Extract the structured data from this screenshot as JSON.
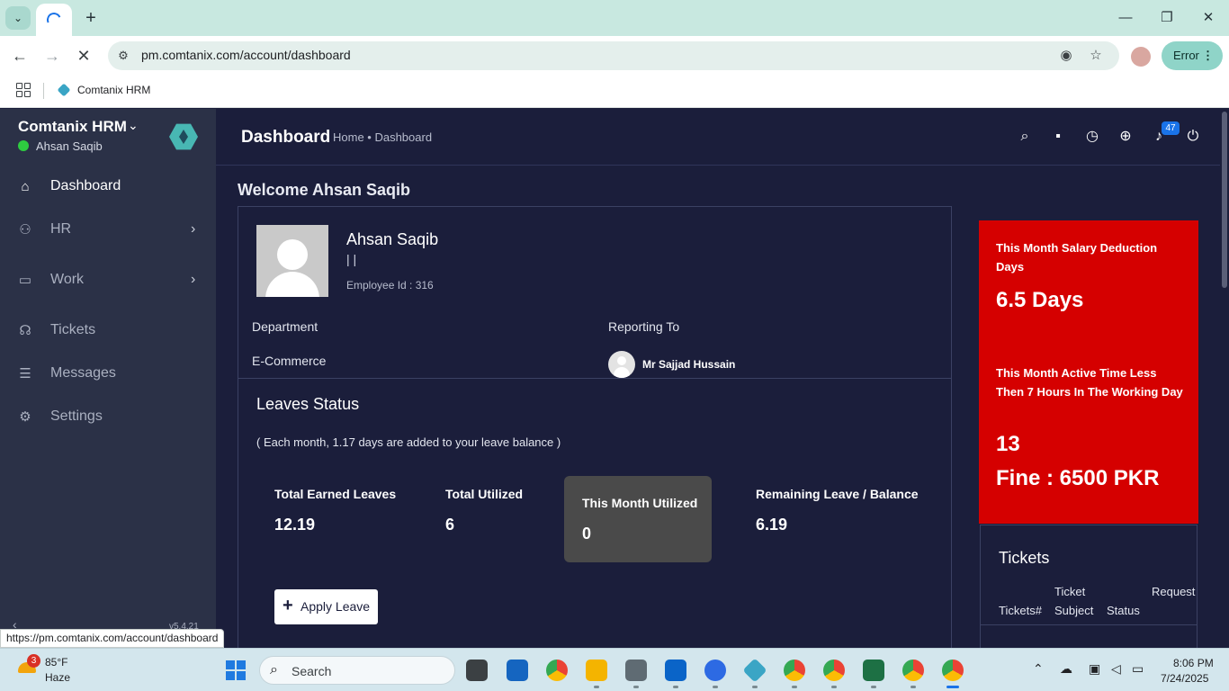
{
  "browser": {
    "tab_dropdown_icon": "chevron-down-icon",
    "new_tab_symbol": "+",
    "window_controls": {
      "minimize": "—",
      "maximize": "❐",
      "close": "✕"
    },
    "url": "pm.comtanix.com/account/dashboard",
    "error_label": "Error",
    "bookmark_label": "Comtanix HRM",
    "status_url": "https://pm.comtanix.com/account/dashboard"
  },
  "sidebar": {
    "brand": "Comtanix HRM",
    "user": "Ahsan Saqib",
    "items": [
      {
        "label": "Dashboard",
        "icon": "home-icon",
        "active": true
      },
      {
        "label": "HR",
        "icon": "users-icon",
        "has_children": true
      },
      {
        "label": "Work",
        "icon": "briefcase-icon",
        "has_children": true
      },
      {
        "label": "Tickets",
        "icon": "headset-icon"
      },
      {
        "label": "Messages",
        "icon": "message-icon"
      },
      {
        "label": "Settings",
        "icon": "gear-icon"
      }
    ],
    "collapse_symbol": "‹",
    "version": "v5.4.21"
  },
  "header": {
    "title": "Dashboard",
    "breadcrumb": "Home • Dashboard",
    "notification_count": "47"
  },
  "main": {
    "welcome": "Welcome Ahsan Saqib",
    "profile": {
      "name": "Ahsan Saqib",
      "bars": "| |",
      "employee_id": "Employee Id : 316",
      "department_label": "Department",
      "department_value": "E-Commerce",
      "reporting_label": "Reporting To",
      "reporting_value": "Mr Sajjad Hussain"
    },
    "leaves": {
      "title": "Leaves Status",
      "note": "( Each month, 1.17 days are added to your leave balance )",
      "stats": [
        {
          "label": "Total Earned Leaves",
          "value": "12.19"
        },
        {
          "label": "Total Utilized",
          "value": "6"
        },
        {
          "label": "This Month Utilized",
          "value": "0"
        },
        {
          "label": "Remaining Leave / Balance",
          "value": "6.19"
        }
      ],
      "apply_label": "Apply Leave"
    }
  },
  "right_panel": {
    "salary_label": "This Month Salary Deduction Days",
    "salary_value": "6.5 Days",
    "active_label": "This Month Active Time Less Then 7 Hours In The Working Day",
    "active_value": "13",
    "fine_value": "Fine : 6500 PKR",
    "color": "#d50000"
  },
  "tickets": {
    "title": "Tickets",
    "headers": [
      "Tickets#",
      "Ticket Subject",
      "Status",
      "Request"
    ]
  },
  "taskbar": {
    "weather_badge": "3",
    "temperature": "85°F",
    "condition": "Haze",
    "search_placeholder": "Search",
    "time": "8:06 PM",
    "date": "7/24/2025"
  }
}
